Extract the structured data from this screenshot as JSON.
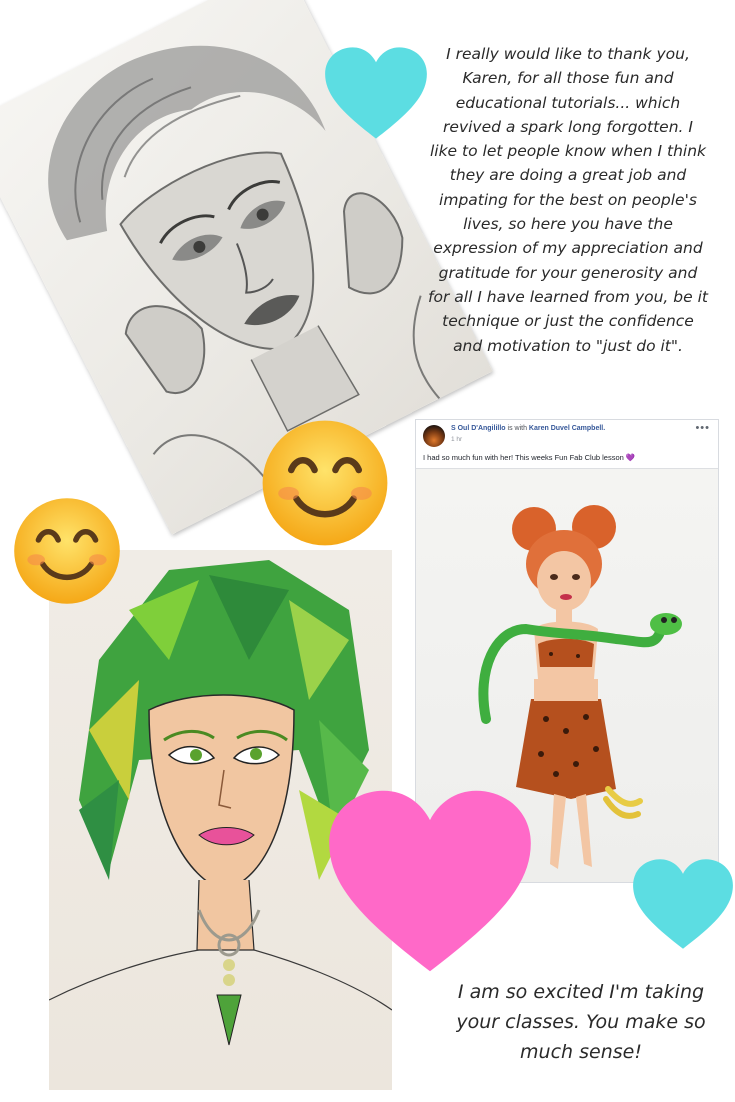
{
  "quotes": {
    "top": "I really would like to thank you, Karen, for all those fun and educational tutorials... which revived a spark long forgotten. I like to let people know when I think they are doing a great job and impating for the best on people's lives, so here you have the expression of my appreciation and gratitude for your generosity and for all I have learned from you, be it technique or just the confidence and motivation to \"just do it\".",
    "bottom": "I am so excited I'm taking your classes. You make so much sense!"
  },
  "facebook_post": {
    "author": "S Oul D'Angilillo",
    "with_text": "is with",
    "tagged": "Karen Duvel Campbell.",
    "time": "1 hr",
    "menu": "•••",
    "text": "I had so much fun with her! This weeks Fun Fab Club lesson 💜"
  },
  "colors": {
    "heart_cyan": "#5cdde2",
    "heart_pink": "#ff69c8",
    "emoji_yellow": "#ffcf3a",
    "link_blue": "#365899"
  },
  "icons": [
    "heart-icon",
    "smiling-face-emoji"
  ]
}
